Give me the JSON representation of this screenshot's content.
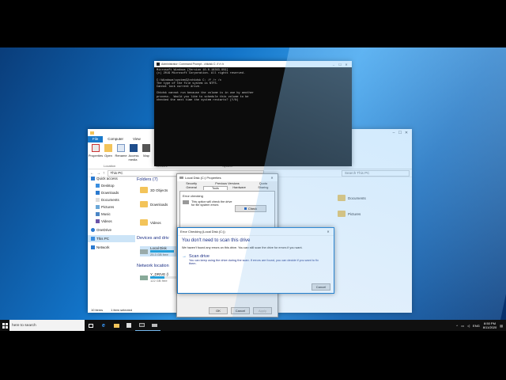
{
  "taskbar": {
    "search_placeholder": "here to search",
    "time": "8:50 PM",
    "date": "8/11/2020",
    "language": "ENG"
  },
  "explorer": {
    "ribbon_tabs": [
      "File",
      "Computer",
      "View"
    ],
    "ribbon_buttons": [
      "Properties",
      "Open",
      "Rename",
      "Access media",
      "Map"
    ],
    "ribbon_groups": [
      "Location",
      "Network",
      "System"
    ],
    "address": "This PC",
    "search_placeholder": "Search This PC",
    "nav_items": [
      "Quick access",
      "Desktop",
      "Downloads",
      "Documents",
      "Pictures",
      "Music",
      "Videos",
      "OneDrive",
      "This PC",
      "Network"
    ],
    "folders_header": "Folders (7)",
    "folders": [
      "3D Objects",
      "Downloads",
      "Videos",
      "Documents",
      "Pictures"
    ],
    "devices_header": "Devices and driv",
    "drive_c_name": "Local Disk",
    "drive_c_free": "25.3 GB free",
    "network_header": "Network location",
    "drive_y_name": "Y_DRIVE (\\",
    "drive_y_free": "122 GB free",
    "status_items": "10 items",
    "status_selected": "1 item selected"
  },
  "cmd": {
    "title": "Administrator: Command Prompt - chkdsk C: /f /r /x",
    "output": "Microsoft Windows [Version 10.0.18363.959]\n(c) 2019 Microsoft Corporation. All rights reserved.\n\nC:\\Windows\\system32>chkdsk C: /f /r /x\nThe type of the file system is NTFS.\nCannot lock current drive.\n\nChkdsk cannot run because the volume is in use by another\nprocess.  Would you like to schedule this volume to be\nchecked the next time the system restarts? (Y/N) "
  },
  "props": {
    "title": "Local Disk (C:) Properties",
    "tabs_row1": [
      "Security",
      "Previous Versions",
      "Quota"
    ],
    "tabs_row2": [
      "General",
      "Tools",
      "Hardware",
      "Sharing"
    ],
    "error_checking_label": "Error checking",
    "error_checking_desc": "This option will check the drive for file system errors",
    "check_button": "Check",
    "ok": "OK",
    "cancel": "Cancel",
    "apply": "Apply"
  },
  "error_dialog": {
    "title": "Error Checking (Local Disk (C:))",
    "heading": "You don't need to scan this drive",
    "message": "We haven't found any errors on this drive. You can still scan the drive for errors if you want.",
    "scan_title": "Scan drive",
    "scan_desc": "You can keep using the drive during the scan. If errors are found, you can decide if you want to fix them.",
    "cancel": "Cancel"
  },
  "colors": {
    "accent": "#1979ca",
    "heading_blue": "#1e3287",
    "taskbar": "#101010"
  }
}
